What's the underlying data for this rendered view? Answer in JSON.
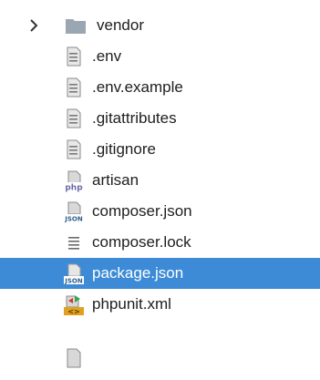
{
  "tree": {
    "items": [
      {
        "label": "vendor",
        "type": "folder",
        "icon": "folder-icon",
        "expanded": false,
        "selected": false
      },
      {
        "label": ".env",
        "type": "file",
        "icon": "text-file-icon",
        "selected": false
      },
      {
        "label": ".env.example",
        "type": "file",
        "icon": "text-file-icon",
        "selected": false
      },
      {
        "label": ".gitattributes",
        "type": "file",
        "icon": "text-file-icon",
        "selected": false
      },
      {
        "label": ".gitignore",
        "type": "file",
        "icon": "text-file-icon",
        "selected": false
      },
      {
        "label": "artisan",
        "type": "file",
        "icon": "php-file-icon",
        "selected": false
      },
      {
        "label": "composer.json",
        "type": "file",
        "icon": "json-file-icon",
        "selected": false
      },
      {
        "label": "composer.lock",
        "type": "file",
        "icon": "lines-file-icon",
        "selected": false
      },
      {
        "label": "package.json",
        "type": "file",
        "icon": "json-file-icon",
        "selected": true
      },
      {
        "label": "phpunit.xml",
        "type": "file",
        "icon": "xml-file-icon",
        "selected": false
      }
    ]
  },
  "colors": {
    "selection": "#3d8bd6",
    "text": "#1e1e1e",
    "folder": "#9aa7b3",
    "php_badge": "#6c67a8",
    "json_badge": "#2f5f8f",
    "xml_badge": "#e0a020",
    "xml_arrow": "#32a852"
  }
}
